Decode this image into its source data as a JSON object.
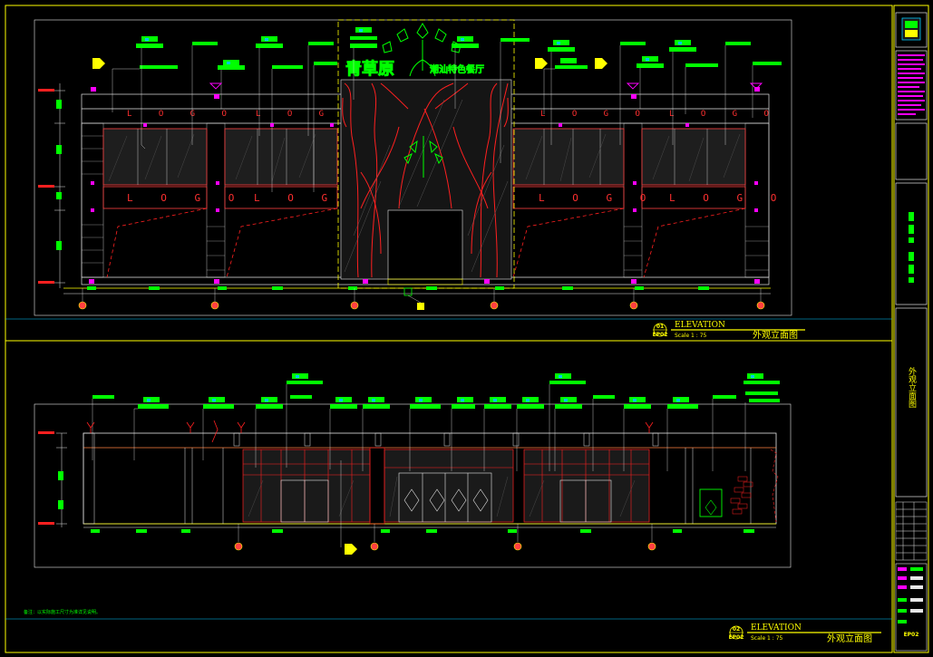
{
  "drawing": {
    "elevation_1": {
      "number": "01",
      "sheet": "EP02",
      "title_en": "ELEVATION",
      "scale": "Scale 1 : 75",
      "title_cn": "外观立面图"
    },
    "elevation_2": {
      "number": "02",
      "sheet": "EP02",
      "title_en": "ELEVATION",
      "scale": "Scale 1 : 75",
      "title_cn": "外观立面图"
    },
    "logo_text": "L O G O",
    "storefront_sign": {
      "name_cn": "青草原",
      "subtitle_cn": "潮汕特色餐厅"
    },
    "note": "备注：以实际施工尺寸为准详见说明。",
    "title_block": {
      "vertical_title": "外观立面图",
      "sheet_no": "EP02"
    }
  },
  "colors": {
    "line_yellow": "#ffff00",
    "line_red": "#ff2020",
    "line_green": "#00ff00",
    "line_white": "#e6e6e6",
    "line_magenta": "#ff00ff",
    "line_cyan": "#00c8ff",
    "background": "#000000"
  }
}
